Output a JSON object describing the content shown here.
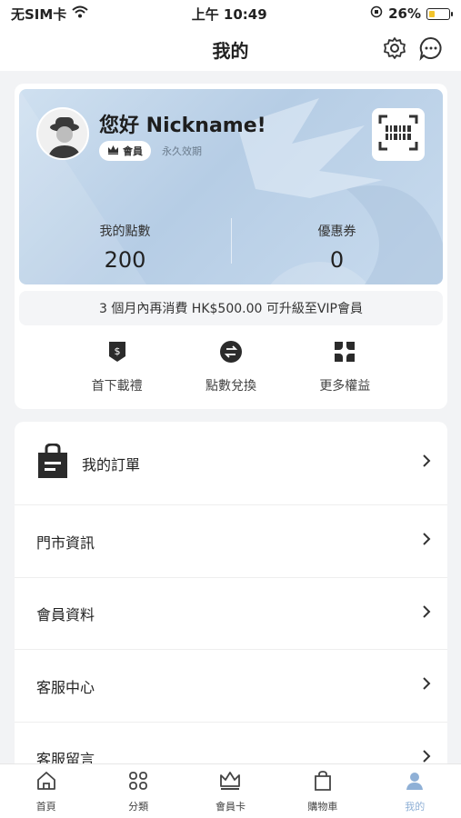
{
  "status_bar": {
    "carrier": "无SIM卡",
    "time": "上午 10:49",
    "battery": "26%"
  },
  "nav": {
    "title": "我的"
  },
  "member_card": {
    "greeting": "您好 Nickname!",
    "member_badge": "會員",
    "validity": "永久效期",
    "points_label": "我的點數",
    "points_value": "200",
    "coupons_label": "優惠券",
    "coupons_value": "0"
  },
  "upgrade_text": "3 個月內再消費 HK$500.00 可升級至VIP會員",
  "benefits": [
    {
      "label": "首下載禮",
      "icon": "dollar-shield-icon"
    },
    {
      "label": "點數兌換",
      "icon": "exchange-icon"
    },
    {
      "label": "更多權益",
      "icon": "grid-icon"
    }
  ],
  "menu": {
    "orders": "我的訂單",
    "items": [
      "門市資訊",
      "會員資料",
      "客服中心",
      "客服留言"
    ]
  },
  "tabs": [
    {
      "label": "首頁",
      "icon": "home-icon"
    },
    {
      "label": "分類",
      "icon": "category-icon"
    },
    {
      "label": "會員卡",
      "icon": "crown-icon"
    },
    {
      "label": "購物車",
      "icon": "bag-icon"
    },
    {
      "label": "我的",
      "icon": "profile-icon"
    }
  ],
  "colors": {
    "accent": "#8fb0d6",
    "card_bg": "#c6d9ec"
  }
}
